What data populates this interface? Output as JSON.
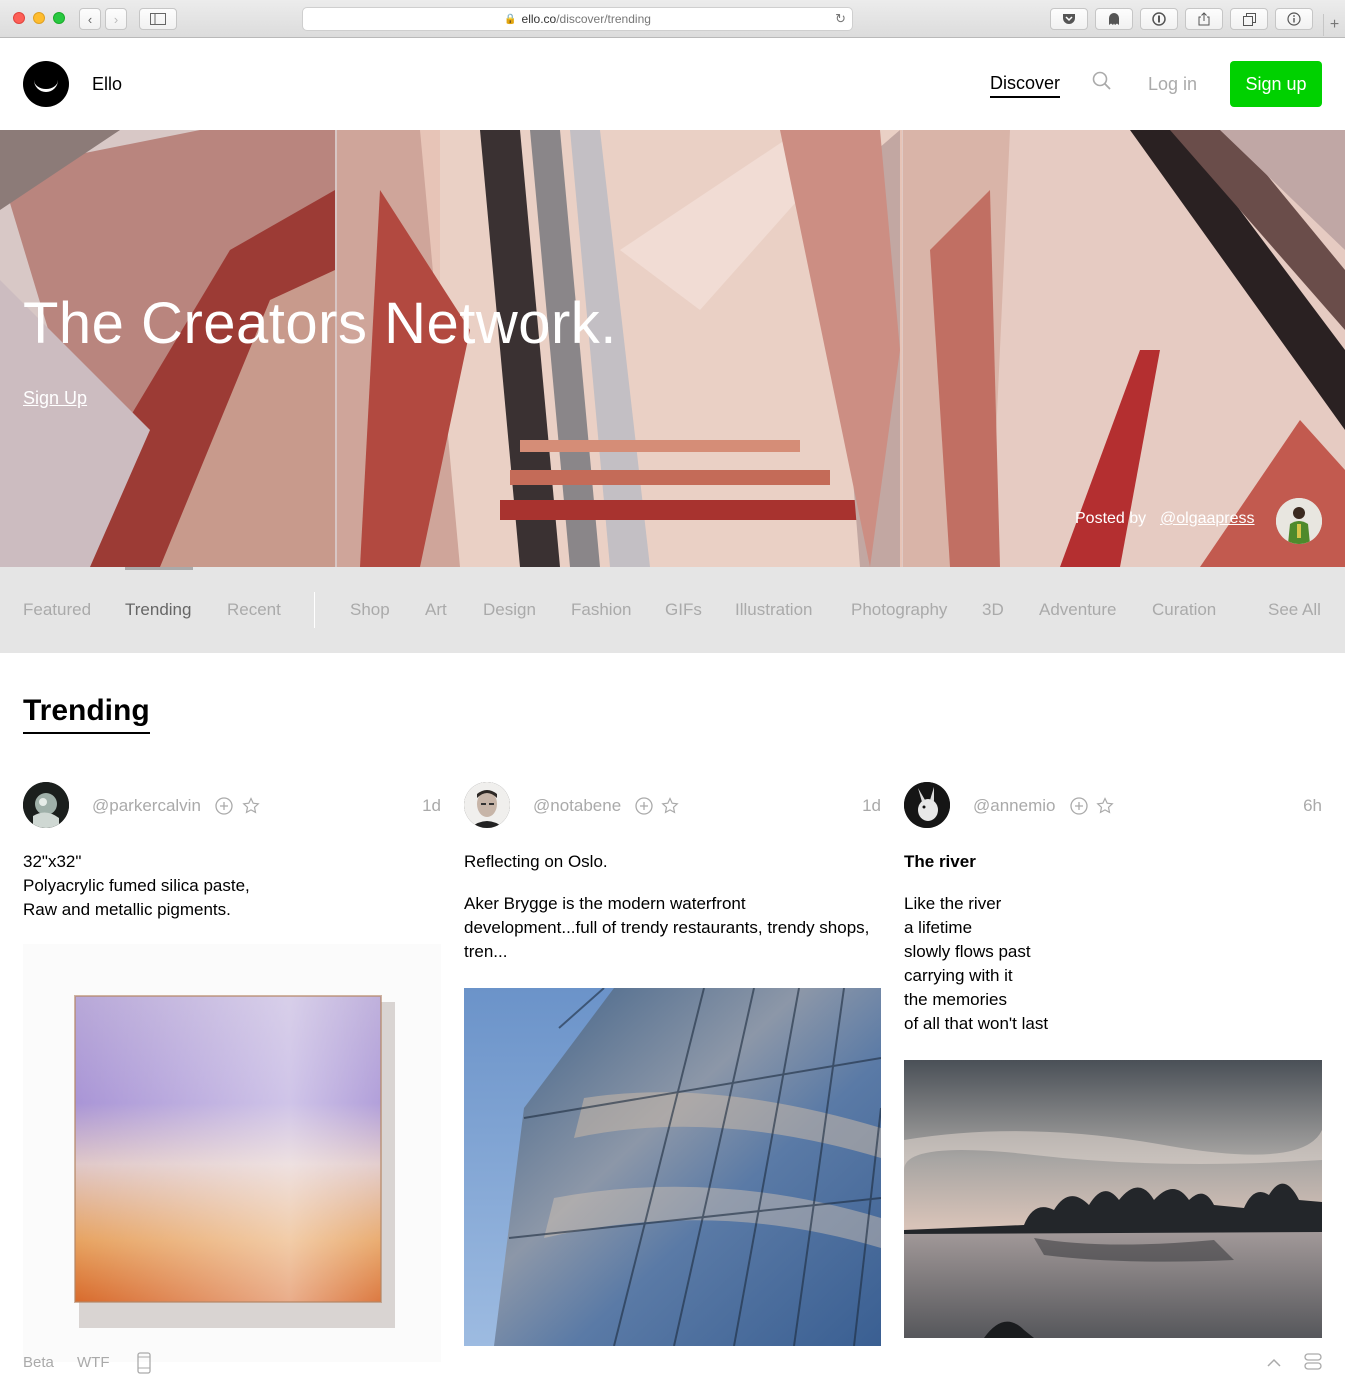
{
  "browser": {
    "url_domain": "ello.co",
    "url_path": "/discover/trending"
  },
  "header": {
    "brand": "Ello",
    "nav_discover": "Discover",
    "nav_login": "Log in",
    "nav_signup": "Sign up"
  },
  "hero": {
    "title": "The Creators Network.",
    "signup_link": "Sign Up",
    "posted_by_label": "Posted by",
    "posted_by_user": "@olgaapress"
  },
  "categories": {
    "items": [
      "Featured",
      "Trending",
      "Recent",
      "Shop",
      "Art",
      "Design",
      "Fashion",
      "GIFs",
      "Illustration",
      "Photography",
      "3D",
      "Adventure",
      "Curation"
    ],
    "active": "Trending",
    "see_all": "See All"
  },
  "section_title": "Trending",
  "posts": [
    {
      "username": "@parkercalvin",
      "time": "1d",
      "paragraphs": [
        "32\"x32\"",
        "Polyacrylic fumed silica paste,",
        "Raw and metallic pigments."
      ]
    },
    {
      "username": "@notabene",
      "time": "1d",
      "paragraphs": [
        "Reflecting on Oslo.",
        "Aker Brygge is the modern waterfront development...full of trendy restaurants, trendy shops, tren..."
      ]
    },
    {
      "username": "@annemio",
      "time": "6h",
      "title": "The river",
      "lines": [
        "Like the river",
        "a lifetime",
        "slowly flows past",
        "carrying with it",
        "the memories",
        "of all that won't last"
      ]
    }
  ],
  "footer": {
    "beta": "Beta",
    "wtf": "WTF"
  },
  "colors": {
    "signup_green": "#00d100",
    "muted_text": "#aaaaaa",
    "catbar_bg": "#e5e5e5"
  },
  "icons": [
    "back-icon",
    "forward-icon",
    "sidebar-icon",
    "lock-icon",
    "reload-icon",
    "pocket-icon",
    "ghostery-icon",
    "onepassword-icon",
    "share-icon",
    "tabs-icon",
    "info-icon",
    "search-icon",
    "repost-icon",
    "love-icon",
    "mobile-icon",
    "scroll-top-icon",
    "grid-toggle-icon"
  ]
}
